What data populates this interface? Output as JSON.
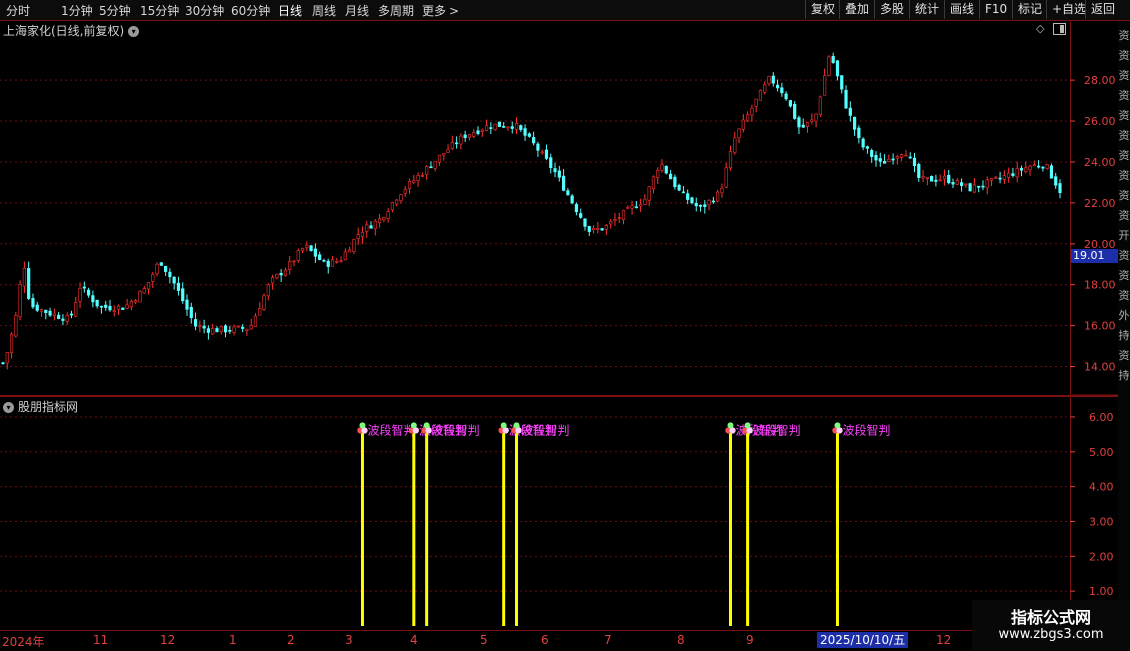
{
  "toolbar": {
    "periods": [
      "分时",
      "1分钟",
      "5分钟",
      "15分钟",
      "30分钟",
      "60分钟",
      "日线",
      "周线",
      "月线",
      "多周期",
      "更多"
    ],
    "active_period": "日线",
    "right_buttons": [
      "复权",
      "叠加",
      "多股",
      "统计",
      "画线",
      "F10",
      "标记",
      "+自选",
      "返回"
    ]
  },
  "price_pane": {
    "stock_title": "上海家化(日线,前复权)",
    "current_price_tag": "19.01"
  },
  "indicator_pane": {
    "title": "股朋指标网",
    "signal_text": "波段智判",
    "overlap_labels": [
      "波段智判",
      "波段智判",
      "波段智判",
      "波段智判",
      "波段智判"
    ]
  },
  "right_strip_chars": [
    "资",
    "资",
    "资",
    "资",
    "资",
    "资",
    "资",
    "资",
    "资",
    "资",
    "开",
    "资",
    "资",
    "资",
    "外",
    "持",
    "资",
    "持"
  ],
  "date_axis": {
    "labels": [
      "2024年",
      "11",
      "12",
      "1",
      "2",
      "3",
      "4",
      "5",
      "6",
      "7",
      "8",
      "9",
      "12"
    ],
    "highlight": "2025/10/10/五"
  },
  "watermark": {
    "title": "指标公式网",
    "url": "www.zbgs3.com"
  },
  "colors": {
    "up": "#ff3030",
    "down": "#54ffff",
    "signal_line": "#ffff00",
    "signal_text": "#ff40ff",
    "axis_red": "#e04040",
    "price_tag": "#1c2fa8"
  },
  "chart_data": [
    {
      "type": "candlestick",
      "name_on_chart": "上海家化",
      "y_ticks": [
        "14.00",
        "16.00",
        "18.00",
        "20.00",
        "22.00",
        "24.00",
        "26.00",
        "28.00"
      ],
      "ylim": [
        13.0,
        30.5
      ],
      "num_bars": 248,
      "close_path_keypoints": [
        [
          0,
          13.8
        ],
        [
          8,
          14.8
        ],
        [
          18,
          16.9
        ],
        [
          23,
          19.4
        ],
        [
          30,
          17.0
        ],
        [
          50,
          16.6
        ],
        [
          70,
          16.3
        ],
        [
          80,
          17.9
        ],
        [
          100,
          16.9
        ],
        [
          125,
          16.9
        ],
        [
          145,
          17.8
        ],
        [
          160,
          19.2
        ],
        [
          175,
          18.0
        ],
        [
          195,
          16.0
        ],
        [
          210,
          15.8
        ],
        [
          230,
          15.8
        ],
        [
          250,
          15.9
        ],
        [
          270,
          18.1
        ],
        [
          290,
          19.0
        ],
        [
          305,
          19.9
        ],
        [
          325,
          19.0
        ],
        [
          340,
          19.2
        ],
        [
          360,
          20.6
        ],
        [
          380,
          21.2
        ],
        [
          400,
          22.5
        ],
        [
          425,
          23.6
        ],
        [
          445,
          24.5
        ],
        [
          465,
          25.3
        ],
        [
          490,
          25.8
        ],
        [
          515,
          25.8
        ],
        [
          535,
          24.8
        ],
        [
          555,
          23.5
        ],
        [
          575,
          21.8
        ],
        [
          590,
          20.6
        ],
        [
          605,
          20.8
        ],
        [
          630,
          21.7
        ],
        [
          645,
          22.2
        ],
        [
          660,
          24.0
        ],
        [
          680,
          22.5
        ],
        [
          700,
          21.7
        ],
        [
          720,
          22.5
        ],
        [
          735,
          25.2
        ],
        [
          755,
          26.9
        ],
        [
          770,
          28.1
        ],
        [
          785,
          27.3
        ],
        [
          800,
          25.6
        ],
        [
          815,
          26.1
        ],
        [
          830,
          29.4
        ],
        [
          845,
          26.9
        ],
        [
          860,
          24.9
        ],
        [
          880,
          23.9
        ],
        [
          905,
          24.6
        ],
        [
          920,
          23.1
        ],
        [
          945,
          23.2
        ],
        [
          970,
          22.7
        ],
        [
          990,
          23.0
        ],
        [
          1010,
          23.4
        ],
        [
          1030,
          23.8
        ],
        [
          1045,
          23.9
        ],
        [
          1060,
          22.6
        ]
      ]
    },
    {
      "type": "bar",
      "name_on_chart": "股朋指标网",
      "y_ticks": [
        "1.00",
        "2.00",
        "3.00",
        "4.00",
        "5.00",
        "6.00"
      ],
      "ylim": [
        0,
        6.4
      ],
      "signal_value": 5.7,
      "signal_positions_px_note": "",
      "signals": [
        {
          "bar_index": 84,
          "value": 5.7
        },
        {
          "bar_index": 96,
          "value": 5.7
        },
        {
          "bar_index": 99,
          "value": 5.7
        },
        {
          "bar_index": 117,
          "value": 5.7
        },
        {
          "bar_index": 120,
          "value": 5.7
        },
        {
          "bar_index": 170,
          "value": 5.7
        },
        {
          "bar_index": 174,
          "value": 5.7
        },
        {
          "bar_index": 195,
          "value": 5.7
        }
      ]
    }
  ]
}
